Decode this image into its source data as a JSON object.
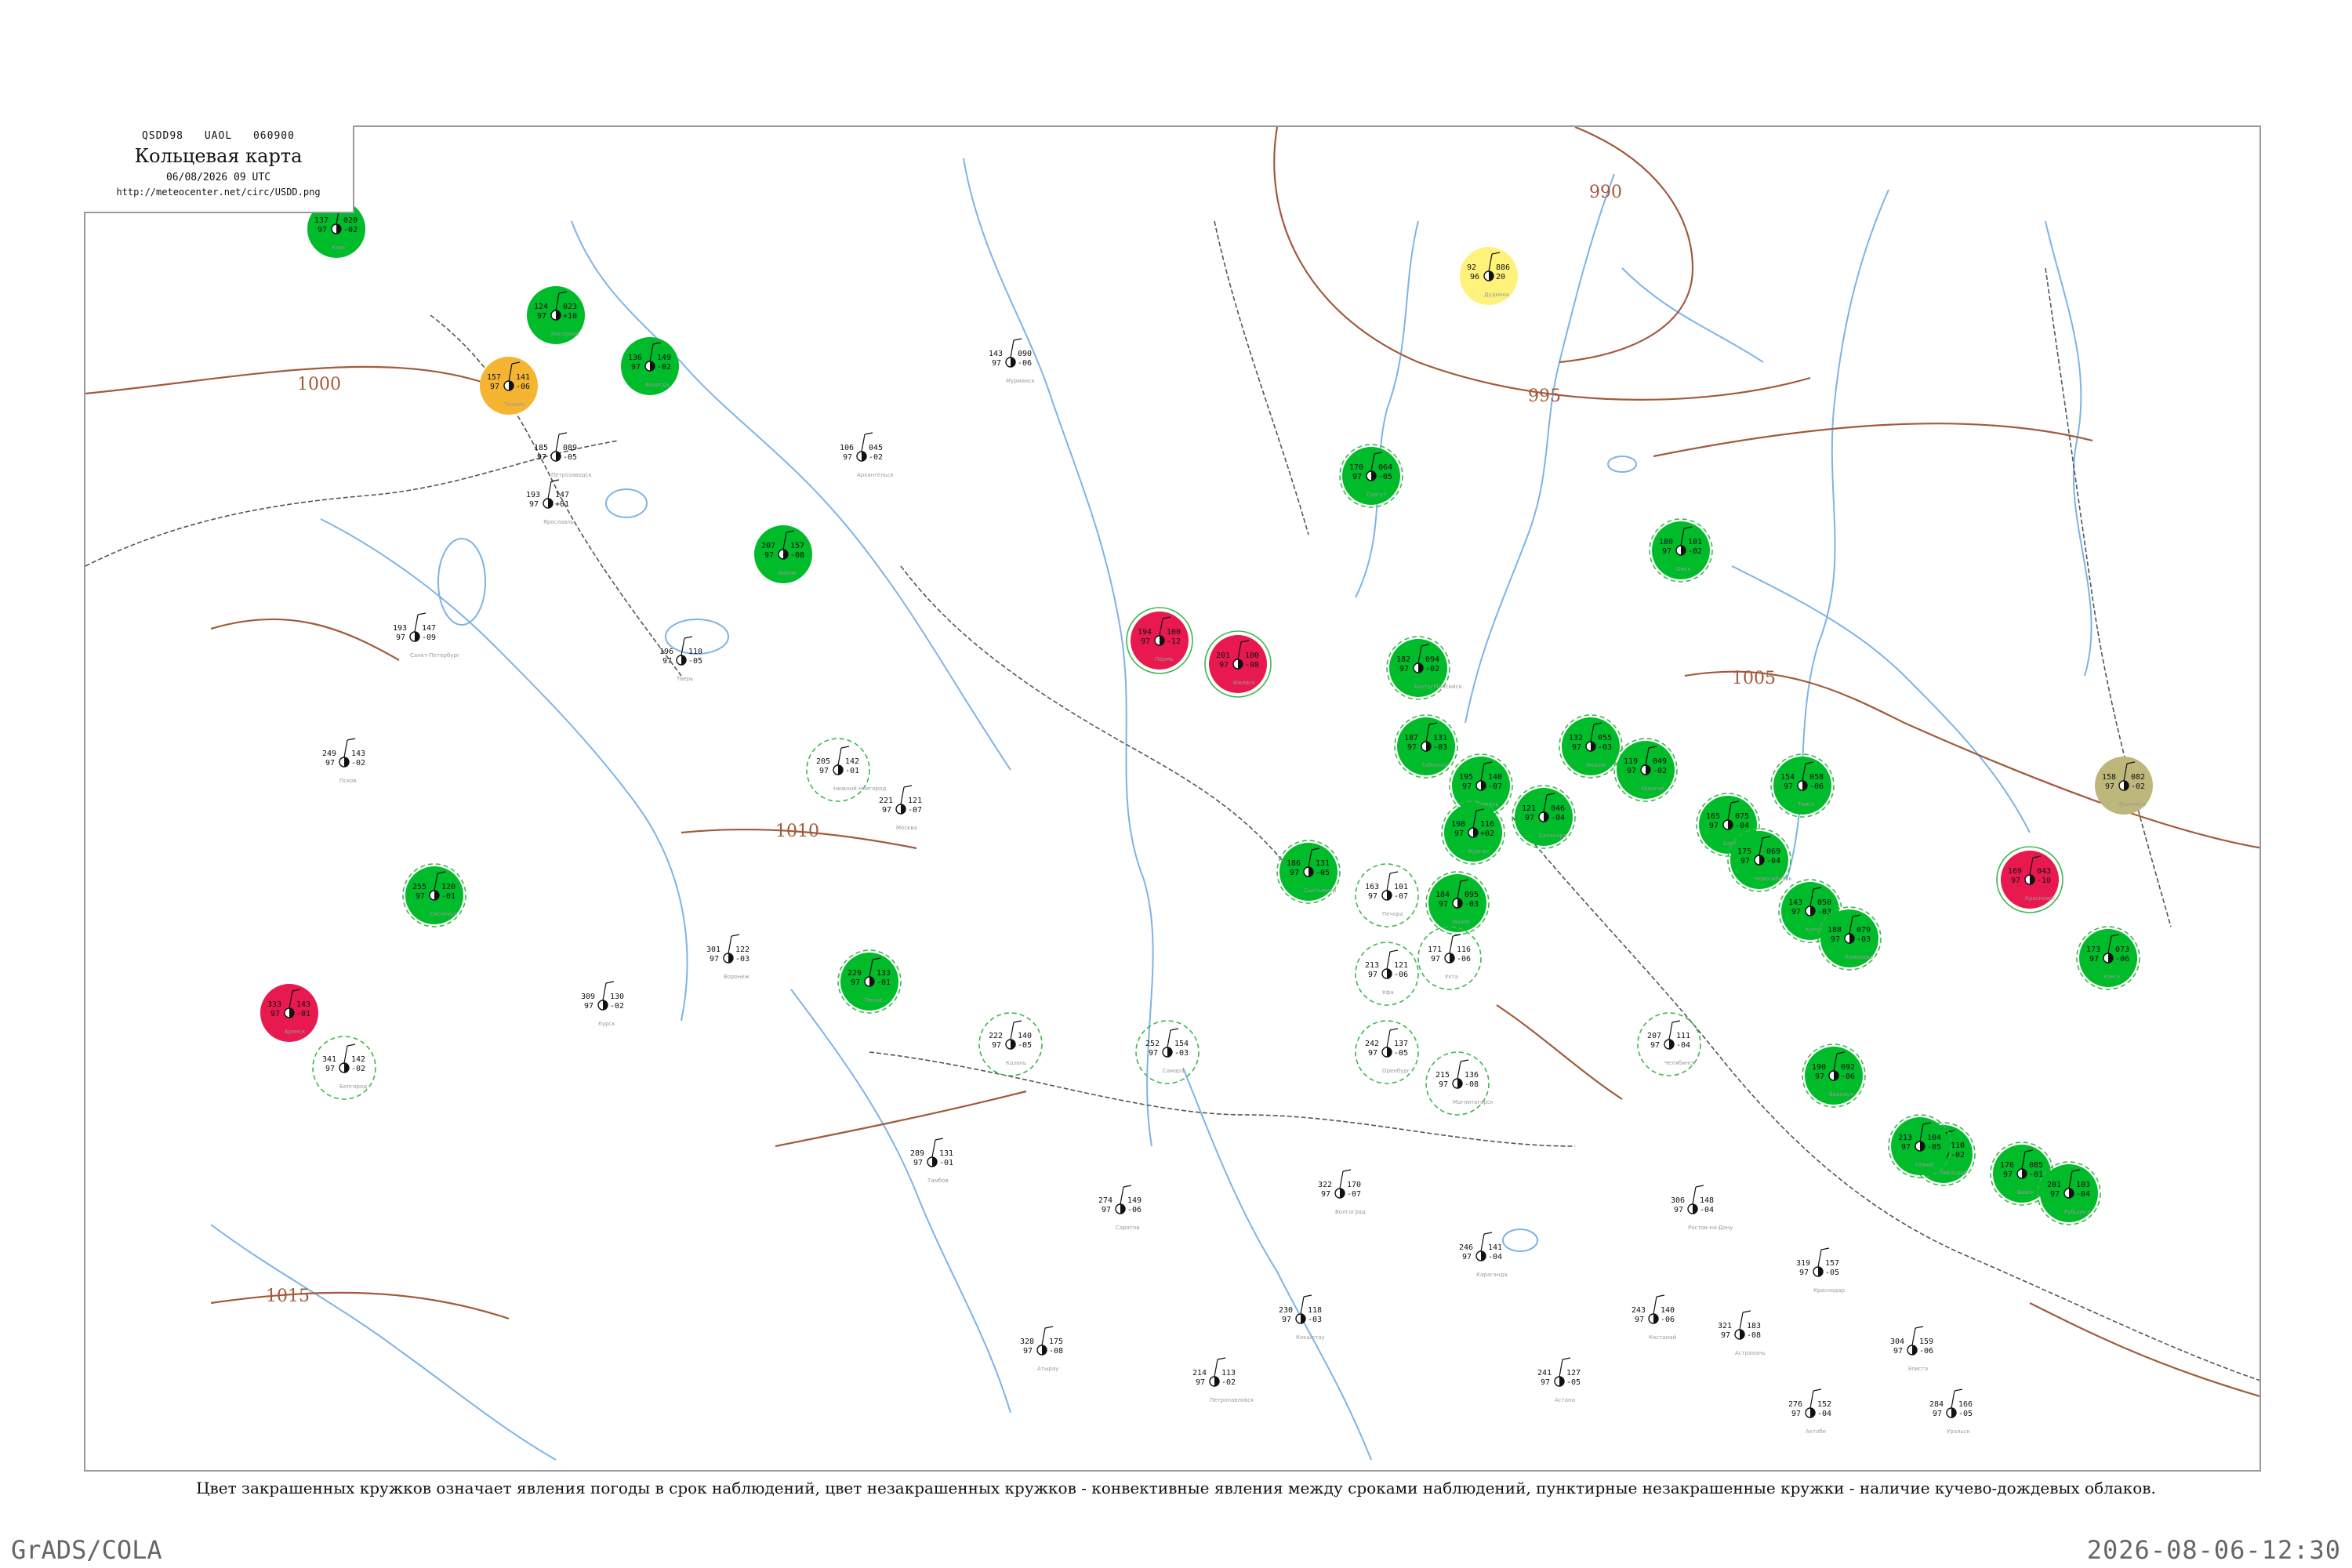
{
  "header": {
    "code1": "QSDD98",
    "code2": "UAOL",
    "code3": "060900",
    "title": "Кольцевая карта",
    "datetime": "06/08/2026 09 UTC",
    "url": "http://meteocenter.net/circ/USDD.png"
  },
  "legend_note": "Цвет закрашенных кружков означает явления погоды в срок наблюдений, цвет незакрашенных кружков - конвективные явления между сроками наблюдений, пунктирные незакрашенные кружки - наличие кучево-дождевых облаков.",
  "footer": {
    "left": "GrADS/COLA",
    "right": "2026-08-06-12:30"
  },
  "colors": {
    "rain": "#00bb2a",
    "thunder": "#e8194f",
    "fog": "#fff27a",
    "haze": "#f5b431",
    "dust": "#bdb77c",
    "convective_ring": "#3db84d",
    "isobar": "#a25a3a",
    "rivers": "#7db4e6",
    "borders": "#555555"
  },
  "isobars": [
    {
      "label": "990"
    },
    {
      "label": "995"
    },
    {
      "label": "1000"
    },
    {
      "label": "1005"
    },
    {
      "label": "1010"
    },
    {
      "label": "1015"
    }
  ],
  "stations": [
    {
      "name": "Кирс",
      "t": "137",
      "td": "97",
      "p": "020",
      "tend": "-02",
      "wx": "rain",
      "ring": "none"
    },
    {
      "name": "Тотьма",
      "t": "157",
      "td": "97",
      "p": "141",
      "tend": "-06",
      "wx": "haze",
      "ring": "none"
    },
    {
      "name": "Вологда",
      "t": "136",
      "td": "97",
      "p": "149",
      "tend": "-02",
      "wx": "rain",
      "ring": "none"
    },
    {
      "name": "Кострома",
      "t": "124",
      "td": "97",
      "p": "023",
      "tend": "+10",
      "wx": "rain",
      "ring": "none"
    },
    {
      "name": "Киров",
      "t": "207",
      "td": "97",
      "p": "157",
      "tend": "-08",
      "wx": "rain",
      "ring": "none"
    },
    {
      "name": "Брянск",
      "t": "333",
      "td": "97",
      "p": "143",
      "tend": "-01",
      "wx": "thunder",
      "ring": "none"
    },
    {
      "name": "Смоленск",
      "t": "255",
      "td": "97",
      "p": "120",
      "tend": "-01",
      "wx": "rain",
      "ring": "dashed"
    },
    {
      "name": "Пенза",
      "t": "229",
      "td": "97",
      "p": "133",
      "tend": "-01",
      "wx": "rain",
      "ring": "dashed"
    },
    {
      "name": "Ижевск",
      "t": "201",
      "td": "97",
      "p": "100",
      "tend": "-08",
      "wx": "thunder",
      "ring": "solid"
    },
    {
      "name": "Пермь",
      "t": "194",
      "td": "97",
      "p": "100",
      "tend": "-12",
      "wx": "thunder",
      "ring": "solid"
    },
    {
      "name": "Сургут",
      "t": "170",
      "td": "97",
      "p": "064",
      "tend": "-05",
      "wx": "rain",
      "ring": "dashed"
    },
    {
      "name": "Ханты-Мансийск",
      "t": "182",
      "td": "97",
      "p": "094",
      "tend": "-02",
      "wx": "rain",
      "ring": "dashed"
    },
    {
      "name": "Тобольск",
      "t": "187",
      "td": "97",
      "p": "131",
      "tend": "-03",
      "wx": "rain",
      "ring": "dashed"
    },
    {
      "name": "Тюмень",
      "t": "195",
      "td": "97",
      "p": "140",
      "tend": "-07",
      "wx": "rain",
      "ring": "dashed"
    },
    {
      "name": "Курган",
      "t": "198",
      "td": "97",
      "p": "116",
      "tend": "+02",
      "wx": "rain",
      "ring": "dashed"
    },
    {
      "name": "Ишим",
      "t": "184",
      "td": "97",
      "p": "095",
      "tend": "-03",
      "wx": "rain",
      "ring": "dashed"
    },
    {
      "name": "Омск",
      "t": "180",
      "td": "97",
      "p": "101",
      "tend": "-02",
      "wx": "rain",
      "ring": "dashed"
    },
    {
      "name": "Барабинск",
      "t": "165",
      "td": "97",
      "p": "075",
      "tend": "-04",
      "wx": "rain",
      "ring": "dashed"
    },
    {
      "name": "Новосибирск",
      "t": "175",
      "td": "97",
      "p": "069",
      "tend": "-04",
      "wx": "rain",
      "ring": "dashed"
    },
    {
      "name": "Томск",
      "t": "154",
      "td": "97",
      "p": "058",
      "tend": "-06",
      "wx": "rain",
      "ring": "dashed"
    },
    {
      "name": "Колпашево",
      "t": "143",
      "td": "97",
      "p": "050",
      "tend": "-03",
      "wx": "rain",
      "ring": "dashed"
    },
    {
      "name": "Красноярск",
      "t": "169",
      "td": "97",
      "p": "043",
      "tend": "-10",
      "wx": "thunder",
      "ring": "solid"
    },
    {
      "name": "Енисейск",
      "t": "158",
      "td": "97",
      "p": "082",
      "tend": "-02",
      "wx": "dust",
      "ring": "none"
    },
    {
      "name": "Канск",
      "t": "173",
      "td": "97",
      "p": "073",
      "tend": "-06",
      "wx": "rain",
      "ring": "dashed"
    },
    {
      "name": "Кемерово",
      "t": "188",
      "td": "97",
      "p": "079",
      "tend": "-03",
      "wx": "rain",
      "ring": "dashed"
    },
    {
      "name": "Барнаул",
      "t": "190",
      "td": "97",
      "p": "092",
      "tend": "-06",
      "wx": "rain",
      "ring": "dashed"
    },
    {
      "name": "Бийск",
      "t": "176",
      "td": "97",
      "p": "085",
      "tend": "-01",
      "wx": "rain",
      "ring": "dashed"
    },
    {
      "name": "Рубцовск",
      "t": "201",
      "td": "97",
      "p": "103",
      "tend": "-04",
      "wx": "rain",
      "ring": "dashed"
    },
    {
      "name": "Павлодар",
      "t": "205",
      "td": "97",
      "p": "110",
      "tend": "-02",
      "wx": "rain",
      "ring": "dashed"
    },
    {
      "name": "Семей",
      "t": "213",
      "td": "97",
      "p": "104",
      "tend": "-05",
      "wx": "rain",
      "ring": "dashed"
    },
    {
      "name": "Салехард",
      "t": "121",
      "td": "97",
      "p": "046",
      "tend": "-04",
      "wx": "rain",
      "ring": "dashed"
    },
    {
      "name": "Надым",
      "t": "132",
      "td": "97",
      "p": "055",
      "tend": "-03",
      "wx": "rain",
      "ring": "dashed"
    },
    {
      "name": "Уренгой",
      "t": "119",
      "td": "97",
      "p": "049",
      "tend": "-02",
      "wx": "rain",
      "ring": "dashed"
    },
    {
      "name": "Сыктывкар",
      "t": "186",
      "td": "97",
      "p": "131",
      "tend": "-05",
      "wx": "rain",
      "ring": "dashed"
    },
    {
      "name": "Печора",
      "t": "163",
      "td": "97",
      "p": "101",
      "tend": "-07",
      "wx": "none",
      "ring": "dashed"
    },
    {
      "name": "Ухта",
      "t": "171",
      "td": "97",
      "p": "116",
      "tend": "-06",
      "wx": "none",
      "ring": "dashed"
    },
    {
      "name": "Дудинка",
      "t": "92",
      "td": "96",
      "p": "886",
      "tend": "20",
      "wx": "fog",
      "ring": "none"
    },
    {
      "name": "Уфа",
      "t": "213",
      "td": "97",
      "p": "121",
      "tend": "-06",
      "wx": "none",
      "ring": "dashed"
    },
    {
      "name": "Оренбург",
      "t": "242",
      "td": "97",
      "p": "137",
      "tend": "-05",
      "wx": "none",
      "ring": "dashed"
    },
    {
      "name": "Челябинск",
      "t": "207",
      "td": "97",
      "p": "111",
      "tend": "-04",
      "wx": "none",
      "ring": "dashed"
    },
    {
      "name": "Магнитогорск",
      "t": "215",
      "td": "97",
      "p": "136",
      "tend": "-08",
      "wx": "none",
      "ring": "dashed"
    },
    {
      "name": "Самара",
      "t": "252",
      "td": "97",
      "p": "154",
      "tend": "-03",
      "wx": "none",
      "ring": "dashed"
    },
    {
      "name": "Казань",
      "t": "222",
      "td": "97",
      "p": "140",
      "tend": "-05",
      "wx": "none",
      "ring": "dashed"
    },
    {
      "name": "Нижний Новгород",
      "t": "205",
      "td": "97",
      "p": "142",
      "tend": "-01",
      "wx": "none",
      "ring": "dashed"
    },
    {
      "name": "Москва",
      "t": "221",
      "td": "97",
      "p": "121",
      "tend": "-07",
      "wx": "none",
      "ring": "none"
    },
    {
      "name": "Тверь",
      "t": "196",
      "td": "97",
      "p": "110",
      "tend": "-05",
      "wx": "none",
      "ring": "none"
    },
    {
      "name": "Ярославль",
      "t": "193",
      "td": "97",
      "p": "147",
      "tend": "+01",
      "wx": "none",
      "ring": "none"
    },
    {
      "name": "Псков",
      "t": "249",
      "td": "97",
      "p": "143",
      "tend": "-02",
      "wx": "none",
      "ring": "none"
    },
    {
      "name": "Санкт-Петербург",
      "t": "193",
      "td": "97",
      "p": "147",
      "tend": "-09",
      "wx": "none",
      "ring": "none"
    },
    {
      "name": "Петрозаводск",
      "t": "185",
      "td": "97",
      "p": "089",
      "tend": "-05",
      "wx": "none",
      "ring": "none"
    },
    {
      "name": "Архангельск",
      "t": "106",
      "td": "97",
      "p": "045",
      "tend": "-02",
      "wx": "none",
      "ring": "none"
    },
    {
      "name": "Мурманск",
      "t": "143",
      "td": "97",
      "p": "090",
      "tend": "-06",
      "wx": "none",
      "ring": "none"
    },
    {
      "name": "Воронеж",
      "t": "301",
      "td": "97",
      "p": "122",
      "tend": "-03",
      "wx": "none",
      "ring": "none"
    },
    {
      "name": "Курск",
      "t": "309",
      "td": "97",
      "p": "130",
      "tend": "-02",
      "wx": "none",
      "ring": "none"
    },
    {
      "name": "Белгород",
      "t": "341",
      "td": "97",
      "p": "142",
      "tend": "-02",
      "wx": "none",
      "ring": "dashed"
    },
    {
      "name": "Тамбов",
      "t": "289",
      "td": "97",
      "p": "131",
      "tend": "-01",
      "wx": "none",
      "ring": "none"
    },
    {
      "name": "Саратов",
      "t": "274",
      "td": "97",
      "p": "149",
      "tend": "-06",
      "wx": "none",
      "ring": "none"
    },
    {
      "name": "Волгоград",
      "t": "322",
      "td": "97",
      "p": "170",
      "tend": "-07",
      "wx": "none",
      "ring": "none"
    },
    {
      "name": "Ростов-на-Дону",
      "t": "306",
      "td": "97",
      "p": "148",
      "tend": "-04",
      "wx": "none",
      "ring": "none"
    },
    {
      "name": "Краснодар",
      "t": "319",
      "td": "97",
      "p": "157",
      "tend": "-05",
      "wx": "none",
      "ring": "none"
    },
    {
      "name": "Астрахань",
      "t": "321",
      "td": "97",
      "p": "183",
      "tend": "-08",
      "wx": "none",
      "ring": "none"
    },
    {
      "name": "Элиста",
      "t": "304",
      "td": "97",
      "p": "159",
      "tend": "-06",
      "wx": "none",
      "ring": "none"
    },
    {
      "name": "Уральск",
      "t": "284",
      "td": "97",
      "p": "166",
      "tend": "-05",
      "wx": "none",
      "ring": "none"
    },
    {
      "name": "Актобе",
      "t": "276",
      "td": "97",
      "p": "152",
      "tend": "-04",
      "wx": "none",
      "ring": "none"
    },
    {
      "name": "Костанай",
      "t": "243",
      "td": "97",
      "p": "140",
      "tend": "-06",
      "wx": "none",
      "ring": "none"
    },
    {
      "name": "Астана",
      "t": "241",
      "td": "97",
      "p": "127",
      "tend": "-05",
      "wx": "none",
      "ring": "none"
    },
    {
      "name": "Караганда",
      "t": "246",
      "td": "97",
      "p": "141",
      "tend": "-04",
      "wx": "none",
      "ring": "none"
    },
    {
      "name": "Кокшетау",
      "t": "230",
      "td": "97",
      "p": "118",
      "tend": "-03",
      "wx": "none",
      "ring": "none"
    },
    {
      "name": "Петропавловск",
      "t": "214",
      "td": "97",
      "p": "113",
      "tend": "-02",
      "wx": "none",
      "ring": "none"
    },
    {
      "name": "Атырау",
      "t": "328",
      "td": "97",
      "p": "175",
      "tend": "-08",
      "wx": "none",
      "ring": "none"
    }
  ]
}
